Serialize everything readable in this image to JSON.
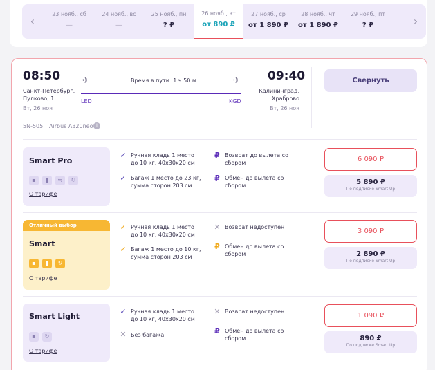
{
  "date_strip": {
    "prev_arrow": "‹",
    "next_arrow": "›",
    "dates": [
      {
        "date": "23 нояб., сб",
        "price": "—"
      },
      {
        "date": "24 нояб., вс",
        "price": "—"
      },
      {
        "date": "25 нояб., пн",
        "price": "? ₽"
      },
      {
        "date": "26 нояб., вт",
        "price": "от 890 ₽",
        "active": true
      },
      {
        "date": "27 нояб., ср",
        "price": "от 1 890 ₽"
      },
      {
        "date": "28 нояб., чт",
        "price": "от 1 890 ₽"
      },
      {
        "date": "29 нояб., пт",
        "price": "? ₽"
      }
    ]
  },
  "flight": {
    "departure_time": "08:50",
    "departure_place": "Санкт-Петербург,\nПулково, 1",
    "departure_date": "Вт, 26 ноя",
    "duration": "Время в пути: 1 ч 50 м",
    "from_code": "LED",
    "to_code": "KGD",
    "arrival_time": "09:40",
    "arrival_place": "Калининград,\nХраброво",
    "arrival_date": "Вт, 26 ноя",
    "flight_number": "5N-505",
    "aircraft": "Airbus A320neo",
    "collapse_label": "Свернуть"
  },
  "tariffs": [
    {
      "name": "Smart Pro",
      "badge": "",
      "about": "О тарифе",
      "feature_1": "Ручная кладь 1 место\nдо 10 кг, 40х30х20 см",
      "feature_2": "Багаж 1 место до 23 кг,\nсумма сторон 203 см",
      "feature_3": "Возврат до вылета со\nсбором",
      "feature_4": "Обмен до вылета со\nсбором",
      "price": "6 090 ₽",
      "sub_price": "5 890 ₽",
      "sub_label": "По подписке Smart Up"
    },
    {
      "name": "Smart",
      "badge": "Отличный выбор",
      "about": "О тарифе",
      "feature_1": "Ручная кладь 1 место\nдо 10 кг, 40х30х20 см",
      "feature_2": "Багаж 1 место до 10 кг,\nсумма сторон 203 см",
      "feature_3": "Возврат недоступен",
      "feature_4": "Обмен до вылета со\nсбором",
      "price": "3 090 ₽",
      "sub_price": "2 890 ₽",
      "sub_label": "По подписке Smart Up"
    },
    {
      "name": "Smart Light",
      "badge": "",
      "about": "О тарифе",
      "feature_1": "Ручная кладь 1 место\nдо 10 кг, 40х30х20 см",
      "feature_2": "Без багажа",
      "feature_3": "Возврат недоступен",
      "feature_4": "Обмен до вылета со\nсбором",
      "price": "1 090 ₽",
      "sub_price": "890 ₽",
      "sub_label": "По подписке Smart Up"
    }
  ],
  "colors": {
    "accent": "#e8505b",
    "brand": "#5a2bb8",
    "gold": "#f7b733",
    "teal": "#1aa3b8"
  }
}
